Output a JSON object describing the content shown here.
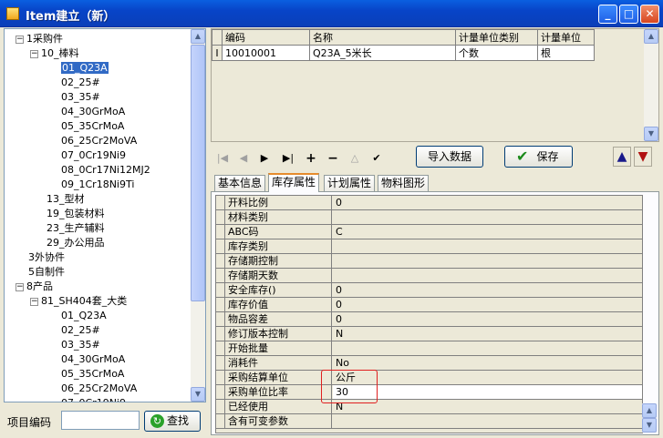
{
  "window": {
    "title": "Item建立（新）"
  },
  "tree": {
    "nodes": [
      {
        "label": "1采购件",
        "expander": "−"
      },
      {
        "label": "10_棒料",
        "expander": "−"
      },
      {
        "label": "01_Q23A",
        "selected": true
      },
      {
        "label": "02_25#"
      },
      {
        "label": "03_35#"
      },
      {
        "label": "04_30GrMoA"
      },
      {
        "label": "05_35CrMoA"
      },
      {
        "label": "06_25Cr2MoVA"
      },
      {
        "label": "07_0Cr19Ni9"
      },
      {
        "label": "08_0Cr17Ni12MJ2"
      },
      {
        "label": "09_1Cr18Ni9Ti"
      },
      {
        "label": "13_型材"
      },
      {
        "label": "19_包装材料"
      },
      {
        "label": "23_生产辅料"
      },
      {
        "label": "29_办公用品"
      },
      {
        "label": "3外协件"
      },
      {
        "label": "5自制件"
      },
      {
        "label": "8产品",
        "expander": "−"
      },
      {
        "label": "81_SH404套_大类",
        "expander": "−"
      },
      {
        "label": "01_Q23A"
      },
      {
        "label": "02_25#"
      },
      {
        "label": "03_35#"
      },
      {
        "label": "04_30GrMoA"
      },
      {
        "label": "05_35CrMoA"
      },
      {
        "label": "06_25Cr2MoVA"
      },
      {
        "label": "07_0Cr19Ni9"
      }
    ]
  },
  "search": {
    "label": "项目编码",
    "value": "",
    "button_label": "查找"
  },
  "item_grid": {
    "columns": [
      "编码",
      "名称",
      "计量单位类别",
      "计量单位"
    ],
    "rows": [
      {
        "indicator": "I",
        "cells": [
          "10010001",
          "Q23A_5米长",
          "个数",
          "根"
        ]
      }
    ]
  },
  "nav": {
    "import_label": "导入数据",
    "save_label": "保存"
  },
  "tabs": [
    "基本信息",
    "库存属性",
    "计划属性",
    "物料图形"
  ],
  "active_tab": "库存属性",
  "properties": [
    {
      "key": "开料比例",
      "value": "0"
    },
    {
      "key": "材料类别",
      "value": ""
    },
    {
      "key": "ABC码",
      "value": "C"
    },
    {
      "key": "库存类别",
      "value": ""
    },
    {
      "key": "存储期控制",
      "value": ""
    },
    {
      "key": "存储期天数",
      "value": ""
    },
    {
      "key": "安全库存()",
      "value": "0"
    },
    {
      "key": "库存价值",
      "value": "0"
    },
    {
      "key": "物品容差",
      "value": "0"
    },
    {
      "key": "修订版本控制",
      "value": "N"
    },
    {
      "key": "开始批量",
      "value": ""
    },
    {
      "key": "消耗件",
      "value": "No"
    },
    {
      "key": "采购结算单位",
      "value": "公斤"
    },
    {
      "key": "采购单位比率",
      "value": "30"
    },
    {
      "key": "已经使用",
      "value": "N"
    },
    {
      "key": "含有可变参数",
      "value": ""
    }
  ],
  "colors": {
    "title_bar": "#0a4fd8",
    "highlight_box": "#e02020",
    "selection": "#316ac5"
  }
}
